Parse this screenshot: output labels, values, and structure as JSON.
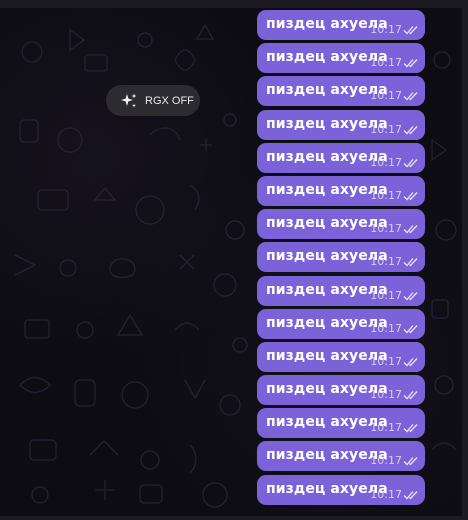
{
  "overlay": {
    "label": "RGX OFF",
    "icon": "sparkles-icon"
  },
  "messages": [
    {
      "text": "пиздец ахуела",
      "time": "10:17",
      "status": "read"
    },
    {
      "text": "пиздец ахуела",
      "time": "10:17",
      "status": "read"
    },
    {
      "text": "пиздец ахуела",
      "time": "10:17",
      "status": "read"
    },
    {
      "text": "пиздец ахуела",
      "time": "10:17",
      "status": "read"
    },
    {
      "text": "пиздец ахуела",
      "time": "10:17",
      "status": "read"
    },
    {
      "text": "пиздец ахуела",
      "time": "10:17",
      "status": "read"
    },
    {
      "text": "пиздец ахуела",
      "time": "10:17",
      "status": "read"
    },
    {
      "text": "пиздец ахуела",
      "time": "10:17",
      "status": "read"
    },
    {
      "text": "пиздец ахуела",
      "time": "10:17",
      "status": "read"
    },
    {
      "text": "пиздец ахуела",
      "time": "10:17",
      "status": "read"
    },
    {
      "text": "пиздец ахуела",
      "time": "10:17",
      "status": "read"
    },
    {
      "text": "пиздец ахуела",
      "time": "10:17",
      "status": "read"
    },
    {
      "text": "пиздец ахуела",
      "time": "10:17",
      "status": "read"
    },
    {
      "text": "пиздец ахуела",
      "time": "10:17",
      "status": "read"
    },
    {
      "text": "пиздец ахуела",
      "time": "10:17",
      "status": "read"
    }
  ],
  "colors": {
    "bubble": "#7b62d9",
    "background": "#0d0c12",
    "pill": "#2c2c30"
  }
}
